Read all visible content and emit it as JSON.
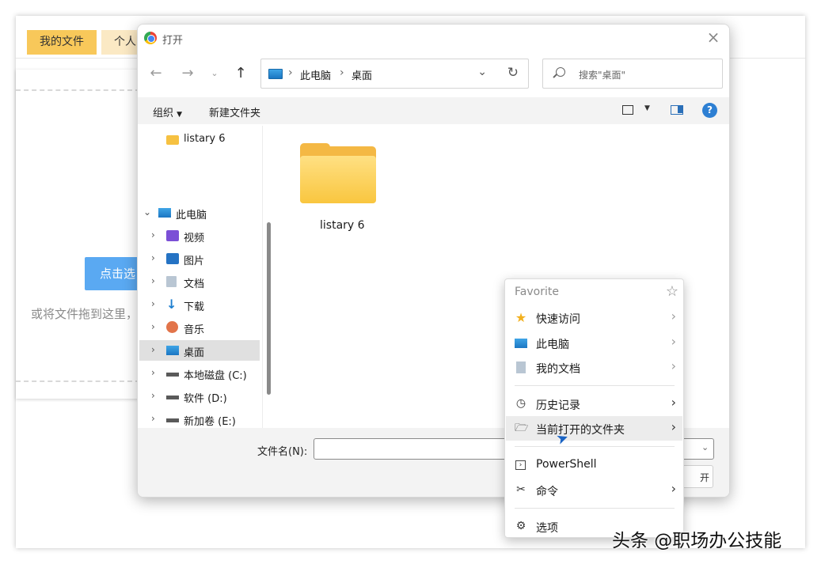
{
  "background_page": {
    "tabs": [
      "我的文件",
      "个人"
    ],
    "upload_button": "点击选",
    "hint": "或将文件拖到这里，"
  },
  "dialog": {
    "title": "打开",
    "breadcrumb": [
      "此电脑",
      "桌面"
    ],
    "search_placeholder": "搜索\"桌面\"",
    "toolbar": {
      "organize": "组织",
      "new_folder": "新建文件夹",
      "help": "?"
    },
    "sidebar": [
      {
        "label": "listary 6",
        "icon": "folder-icon",
        "expandable": false
      },
      {
        "label": "此电脑",
        "icon": "computer-icon",
        "expandable": true,
        "expanded": true
      },
      {
        "label": "视频",
        "icon": "video-icon",
        "expandable": true
      },
      {
        "label": "图片",
        "icon": "picture-icon",
        "expandable": true
      },
      {
        "label": "文档",
        "icon": "document-icon",
        "expandable": true
      },
      {
        "label": "下载",
        "icon": "download-icon",
        "expandable": true
      },
      {
        "label": "音乐",
        "icon": "music-icon",
        "expandable": true
      },
      {
        "label": "桌面",
        "icon": "desktop-icon",
        "expandable": true,
        "selected": true
      },
      {
        "label": "本地磁盘 (C:)",
        "icon": "drive-icon",
        "expandable": true
      },
      {
        "label": "软件 (D:)",
        "icon": "drive-icon",
        "expandable": true
      },
      {
        "label": "新加卷 (E:)",
        "icon": "drive-icon",
        "expandable": true
      }
    ],
    "files": [
      {
        "name": "listary 6",
        "icon": "folder-icon"
      }
    ],
    "filename_label": "文件名(N):",
    "filename_value": "",
    "open_button_fragment": "开"
  },
  "listary_menu": {
    "header": "Favorite",
    "items": [
      {
        "label": "快速访问",
        "icon": "star-icon"
      },
      {
        "label": "此电脑",
        "icon": "computer-icon"
      },
      {
        "label": "我的文档",
        "icon": "document-icon"
      },
      {
        "label": "历史记录",
        "icon": "history-icon"
      },
      {
        "label": "当前打开的文件夹",
        "icon": "folder-open-icon",
        "highlighted": true
      },
      {
        "label": "PowerShell",
        "icon": "powershell-icon"
      },
      {
        "label": "命令",
        "icon": "tools-icon"
      },
      {
        "label": "选项",
        "icon": "settings-icon"
      }
    ]
  },
  "watermark": "头条 @职场办公技能",
  "colors": {
    "tab_active": "#f8c85a",
    "tab_inactive": "#fbe9c4",
    "upload_button": "#5aa9f2",
    "accent": "#2d7fd3",
    "folder": "#f9c63f"
  }
}
